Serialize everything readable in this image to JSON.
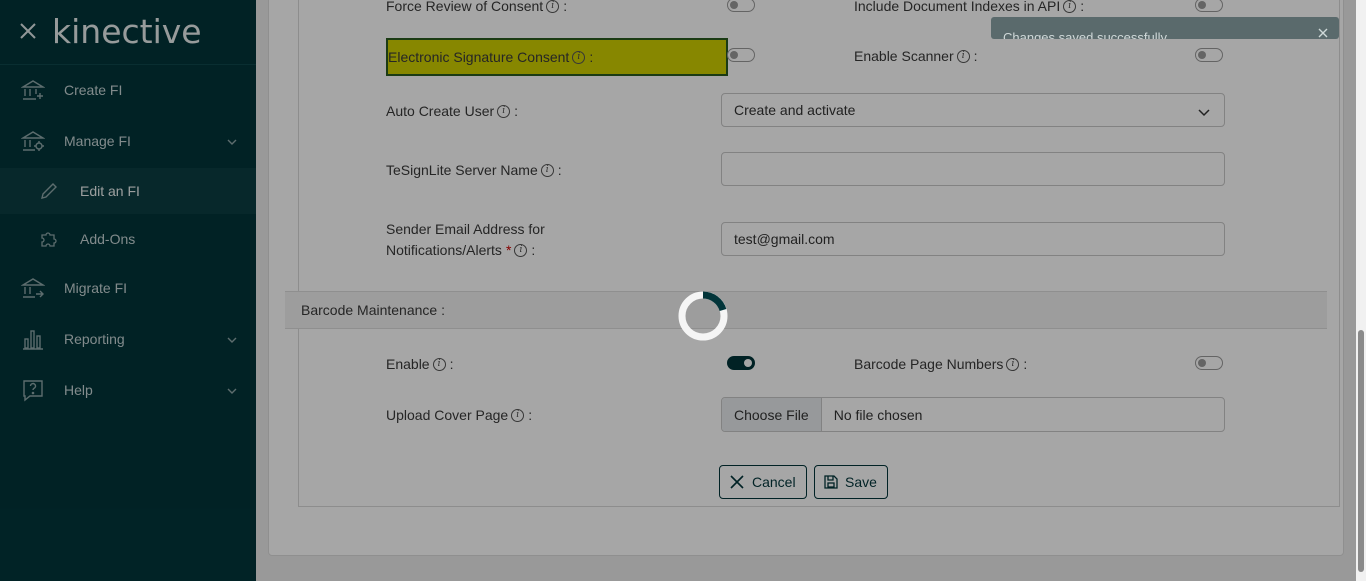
{
  "sidebar": {
    "brand": "kinective",
    "items": [
      {
        "label": "Create FI"
      },
      {
        "label": "Manage FI"
      },
      {
        "label": "Edit an FI"
      },
      {
        "label": "Add-Ons"
      },
      {
        "label": "Migrate FI"
      },
      {
        "label": "Reporting"
      },
      {
        "label": "Help"
      }
    ]
  },
  "form": {
    "force_review_label": "Force Review of Consent",
    "include_doc_indexes_label": "Include Document Indexes in API",
    "esig_consent_label": "Electronic Signature Consent",
    "enable_scanner_label": "Enable Scanner",
    "auto_create_user_label": "Auto Create User",
    "auto_create_user_value": "Create and activate",
    "tesignlite_label": "TeSignLite Server Name",
    "tesignlite_value": "",
    "sender_email_label_line1": "Sender Email Address for",
    "sender_email_label_line2": "Notifications/Alerts",
    "required_mark": "*",
    "sender_email_value": "test@gmail.com",
    "colon": ":",
    "info_glyph": "i"
  },
  "barcode": {
    "section_title": "Barcode Maintenance :",
    "enable_label": "Enable",
    "page_numbers_label": "Barcode Page Numbers",
    "upload_label": "Upload Cover Page",
    "choose_file": "Choose File",
    "no_file": "No file chosen"
  },
  "toggles": {
    "force_review": false,
    "include_doc_indexes": false,
    "esig_consent": false,
    "enable_scanner": false,
    "barcode_enable": true,
    "barcode_page_numbers": false
  },
  "actions": {
    "cancel": "Cancel",
    "save": "Save"
  },
  "toast": {
    "message": "Changes saved successfully"
  },
  "colors": {
    "brand": "#02353a",
    "highlight": "#d0d000"
  }
}
